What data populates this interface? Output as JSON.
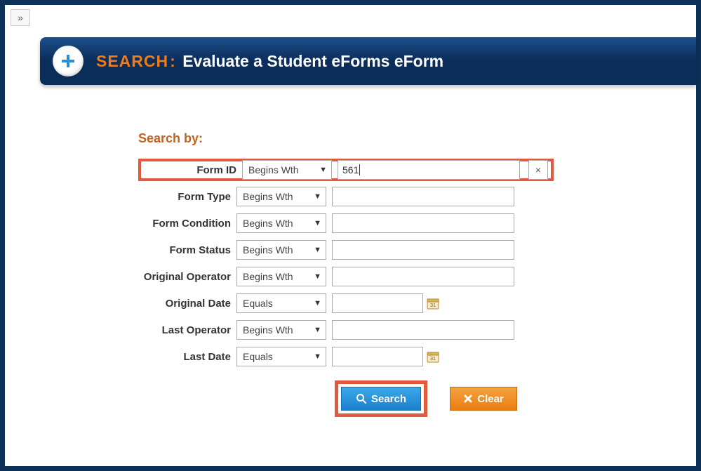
{
  "expand_glyph": "»",
  "header": {
    "search_word": "SEARCH",
    "colon": ":",
    "title_rest": "Evaluate a Student eForms eForm"
  },
  "search_by_label": "Search by:",
  "operators": {
    "begins_with": "Begins Wth",
    "equals": "Equals"
  },
  "fields": {
    "form_id": {
      "label": "Form ID",
      "op": "Begins Wth",
      "value": "561",
      "has_clear": true
    },
    "form_type": {
      "label": "Form Type",
      "op": "Begins Wth",
      "value": ""
    },
    "form_condition": {
      "label": "Form Condition",
      "op": "Begins Wth",
      "value": ""
    },
    "form_status": {
      "label": "Form Status",
      "op": "Begins Wth",
      "value": ""
    },
    "orig_operator": {
      "label": "Original Operator",
      "op": "Begins Wth",
      "value": ""
    },
    "orig_date": {
      "label": "Original Date",
      "op": "Equals",
      "value": "",
      "is_date": true
    },
    "last_operator": {
      "label": "Last Operator",
      "op": "Begins Wth",
      "value": ""
    },
    "last_date": {
      "label": "Last Date",
      "op": "Equals",
      "value": "",
      "is_date": true
    }
  },
  "buttons": {
    "search": "Search",
    "clear": "Clear"
  }
}
